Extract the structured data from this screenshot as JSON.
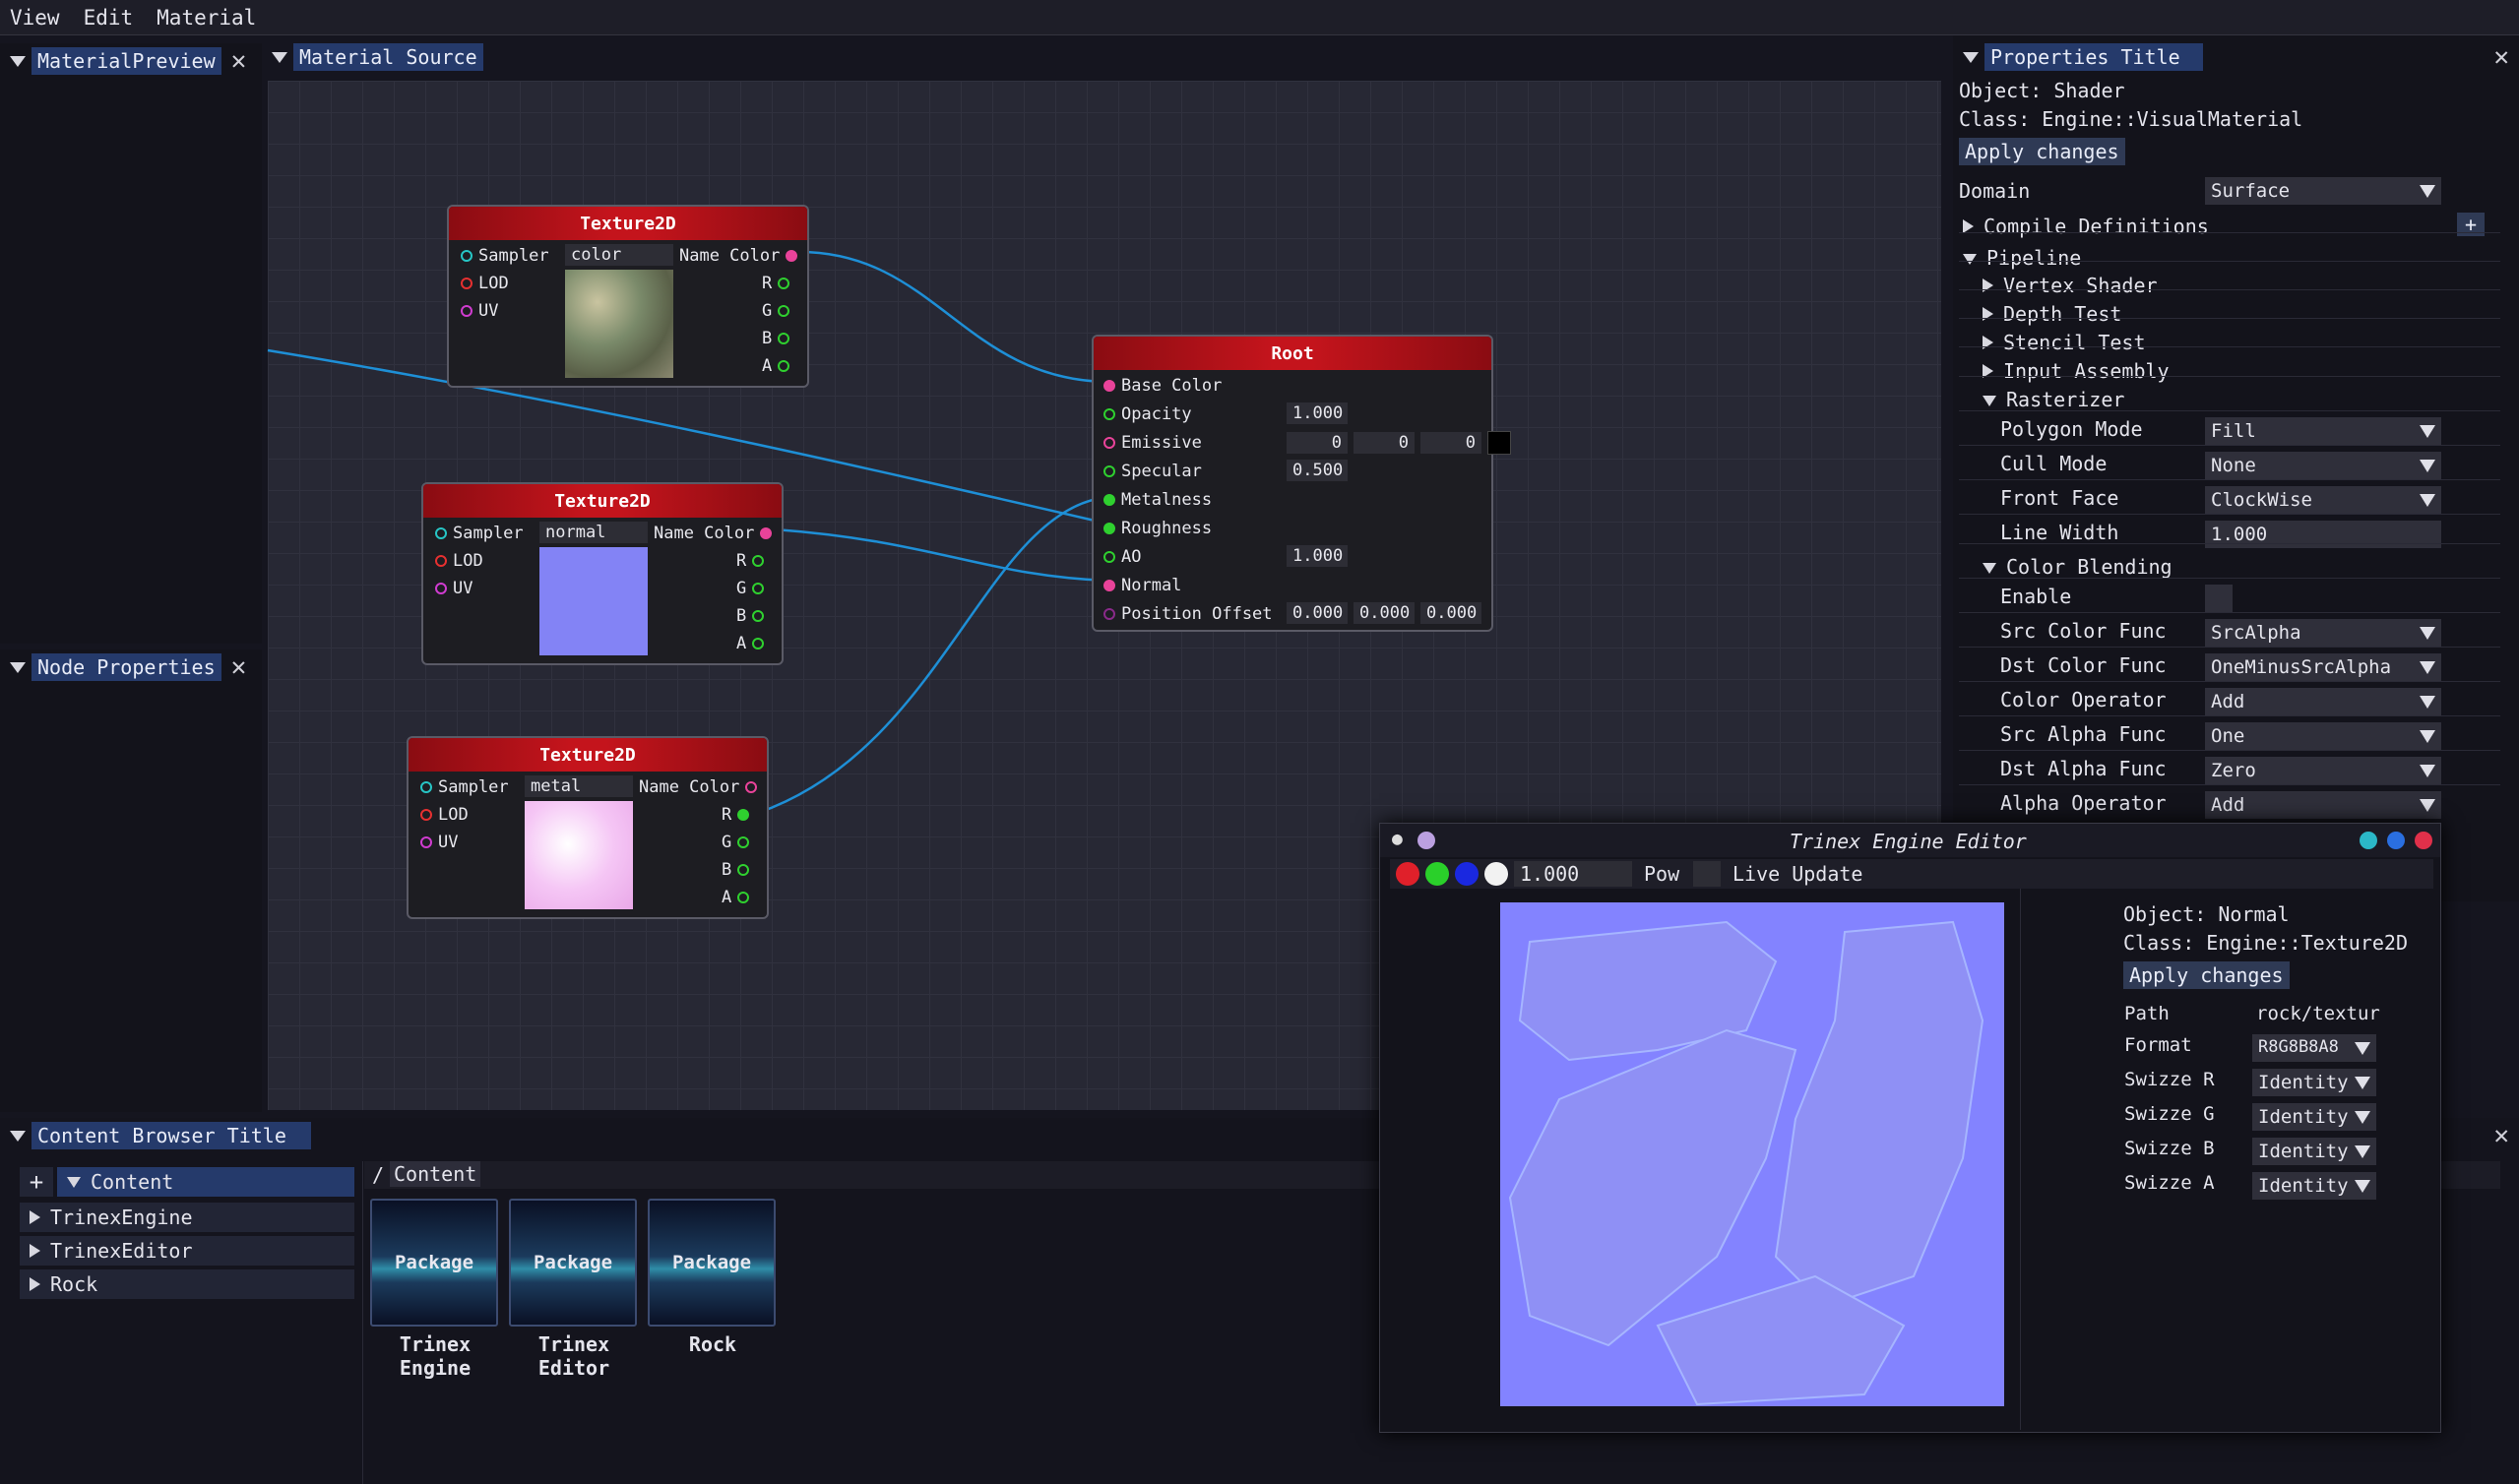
{
  "menu": [
    "View",
    "Edit",
    "Material"
  ],
  "tabs": {
    "material_preview": "MaterialPreview",
    "material_source": "Material Source",
    "node_properties": "Node Properties",
    "properties_title": "Properties Title",
    "content_browser": "Content Browser Title"
  },
  "nodes": {
    "tex1": {
      "title": "Texture2D",
      "sampler": "Sampler",
      "sampler_value": "color",
      "lod": "LOD",
      "uv": "UV",
      "name_color": "Name Color",
      "r": "R",
      "g": "G",
      "b": "B",
      "a": "A"
    },
    "tex2": {
      "title": "Texture2D",
      "sampler": "Sampler",
      "sampler_value": "normal",
      "lod": "LOD",
      "uv": "UV",
      "name_color": "Name Color",
      "r": "R",
      "g": "G",
      "b": "B",
      "a": "A"
    },
    "tex3": {
      "title": "Texture2D",
      "sampler": "Sampler",
      "sampler_value": "metal",
      "lod": "LOD",
      "uv": "UV",
      "name_color": "Name Color",
      "r": "R",
      "g": "G",
      "b": "B",
      "a": "A"
    },
    "root": {
      "title": "Root",
      "base_color": "Base Color",
      "opacity": "Opacity",
      "opacity_value": "1.000",
      "emissive": "Emissive",
      "emissive_values": [
        "0",
        "0",
        "0"
      ],
      "specular": "Specular",
      "specular_value": "0.500",
      "metalness": "Metalness",
      "roughness": "Roughness",
      "ao": "AO",
      "ao_value": "1.000",
      "normal": "Normal",
      "position_offset": "Position Offset",
      "position_values": [
        "0.000",
        "0.000",
        "0.000"
      ]
    }
  },
  "properties": {
    "object": "Object: Shader",
    "class": "Class: Engine::VisualMaterial",
    "apply": "Apply changes",
    "domain_label": "Domain",
    "domain_value": "Surface",
    "compile_definitions": "Compile Definitions",
    "add": "+",
    "pipeline": "Pipeline",
    "vertex_shader": "Vertex Shader",
    "depth_test": "Depth Test",
    "stencil_test": "Stencil Test",
    "input_assembly": "Input Assembly",
    "rasterizer": "Rasterizer",
    "polygon_mode": "Polygon Mode",
    "polygon_mode_value": "Fill",
    "cull_mode": "Cull Mode",
    "cull_mode_value": "None",
    "front_face": "Front Face",
    "front_face_value": "ClockWise",
    "line_width": "Line Width",
    "line_width_value": "1.000",
    "color_blending": "Color Blending",
    "enable": "Enable",
    "src_color": "Src Color Func",
    "src_color_value": "SrcAlpha",
    "dst_color": "Dst Color Func",
    "dst_color_value": "OneMinusSrcAlpha",
    "color_op": "Color Operator",
    "color_op_value": "Add",
    "src_alpha": "Src Alpha Func",
    "src_alpha_value": "One",
    "dst_alpha": "Dst Alpha Func",
    "dst_alpha_value": "Zero",
    "alpha_op": "Alpha Operator",
    "alpha_op_value": "Add"
  },
  "editor": {
    "title": "Trinex Engine Editor",
    "exponent": "1.000",
    "pow": "Pow",
    "live_update": "Live Update",
    "object": "Object: Normal",
    "class": "Class: Engine::Texture2D",
    "apply": "Apply changes",
    "path_label": "Path",
    "path_value": "rock/textur",
    "format_label": "Format",
    "format_value": "R8G8B8A8",
    "swz_r": "Swizze R",
    "swz_r_value": "Identity",
    "swz_g": "Swizze G",
    "swz_g_value": "Identity",
    "swz_b": "Swizze B",
    "swz_b_value": "Identity",
    "swz_a": "Swizze A",
    "swz_a_value": "Identity"
  },
  "content": {
    "add": "+",
    "root": "Content",
    "items": [
      "TrinexEngine",
      "TrinexEditor",
      "Rock"
    ],
    "breadcrumb_sep": "/",
    "breadcrumb": "Content",
    "packages": [
      {
        "icon": "Package",
        "name": "Trinex\nEngine"
      },
      {
        "icon": "Package",
        "name": "Trinex\nEditor"
      },
      {
        "icon": "Package",
        "name": "Rock"
      }
    ]
  },
  "colors": {
    "accent_tab": "#253a6b",
    "node_header": "#c4141c",
    "wire": "#1e8fd6",
    "graph_bg": "#272834",
    "normal_map": "#8080ff"
  }
}
